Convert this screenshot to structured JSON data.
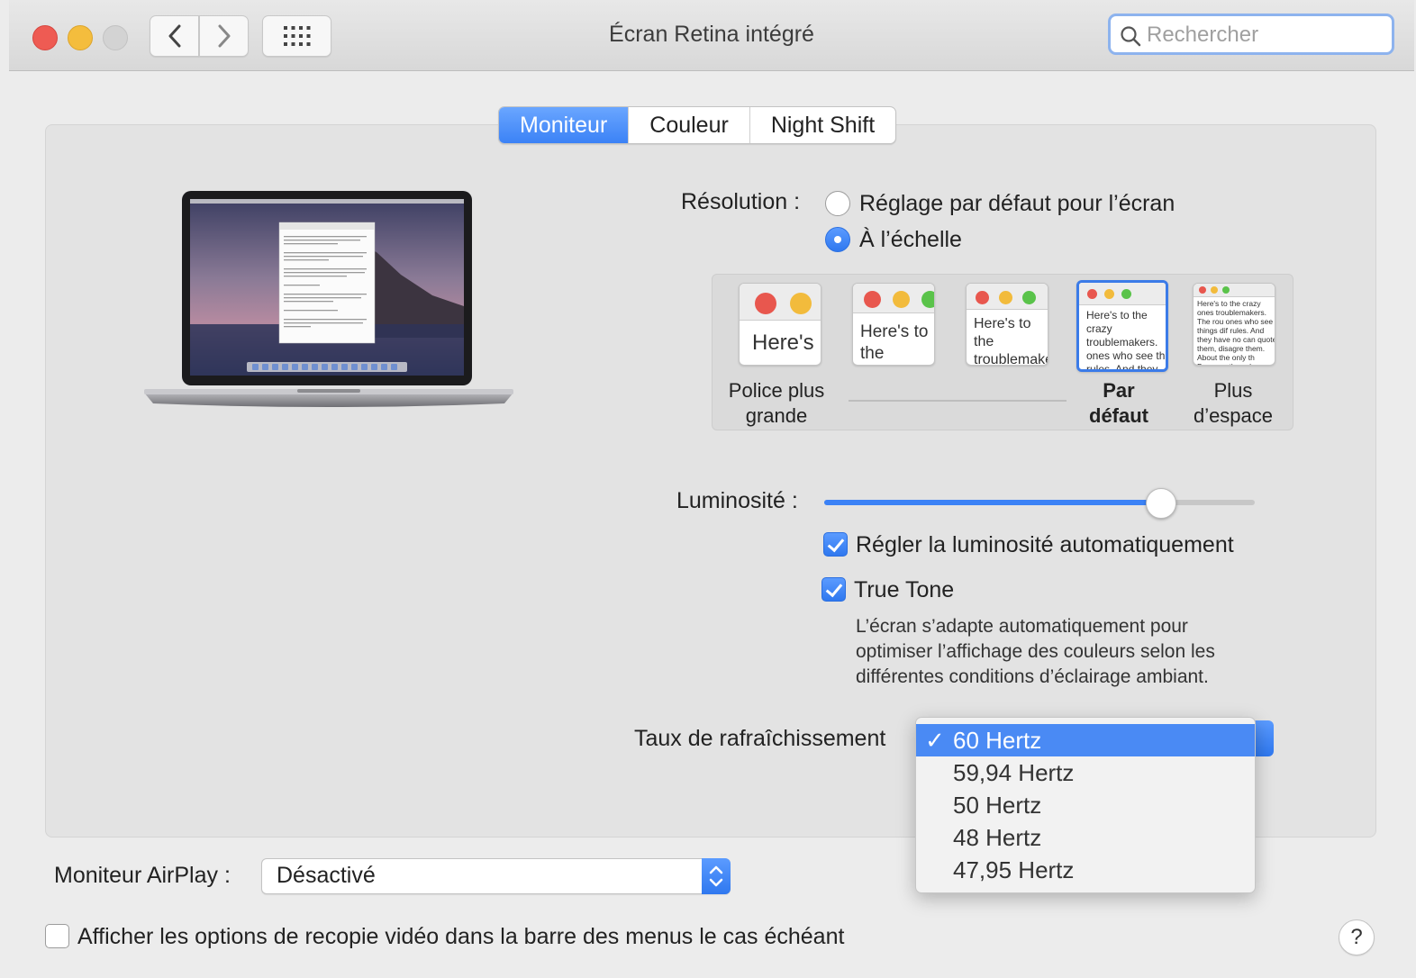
{
  "window": {
    "title": "Écran Retina intégré"
  },
  "search": {
    "placeholder": "Rechercher"
  },
  "tabs": [
    {
      "label": "Moniteur",
      "active": true
    },
    {
      "label": "Couleur",
      "active": false
    },
    {
      "label": "Night Shift",
      "active": false
    }
  ],
  "resolution": {
    "label": "Résolution :",
    "options": [
      {
        "label": "Réglage par défaut pour l’écran",
        "selected": false
      },
      {
        "label": "À l’échelle",
        "selected": true
      }
    ]
  },
  "scaling": {
    "thumbs": [
      {
        "text": "Here's"
      },
      {
        "text": "Here's to the troublemakers"
      },
      {
        "text": "Here's to the troublemakers ones who"
      },
      {
        "text": "Here's to the crazy troublemakers. ones who see th rules. And they"
      },
      {
        "text": "Here's to the crazy ones troublemakers. The rou ones who see things dif rules. And they have no can quote them, disagre them. About the only th Because they change th"
      }
    ],
    "labels": {
      "larger_line1": "Police plus",
      "larger_line2": "grande",
      "default_line1": "Par",
      "default_line2": "défaut",
      "space_line1": "Plus",
      "space_line2": "d’espace"
    },
    "selected_index": 3
  },
  "brightness": {
    "label": "Luminosité :",
    "level": 0.78
  },
  "auto_brightness": {
    "label": "Régler la luminosité automatiquement",
    "checked": true
  },
  "true_tone": {
    "label": "True Tone",
    "checked": true,
    "description_lines": [
      "L’écran s’adapte automatiquement pour",
      "optimiser l’affichage des couleurs selon les",
      "différentes conditions d’éclairage ambiant."
    ]
  },
  "refresh": {
    "label": "Taux de rafraîchissement",
    "options": [
      "60 Hertz",
      "59,94 Hertz",
      "50 Hertz",
      "48 Hertz",
      "47,95 Hertz"
    ],
    "selected": "60 Hertz",
    "check_glyph": "✓"
  },
  "airplay": {
    "label": "Moniteur AirPlay :",
    "value": "Désactivé"
  },
  "mirroring": {
    "label": "Afficher les options de recopie vidéo dans la barre des menus le cas échéant",
    "checked": false
  },
  "help": {
    "label": "?"
  },
  "colors": {
    "accent": "#3b82f6",
    "close": "#ee5b53",
    "minimize": "#f4bd3d"
  }
}
